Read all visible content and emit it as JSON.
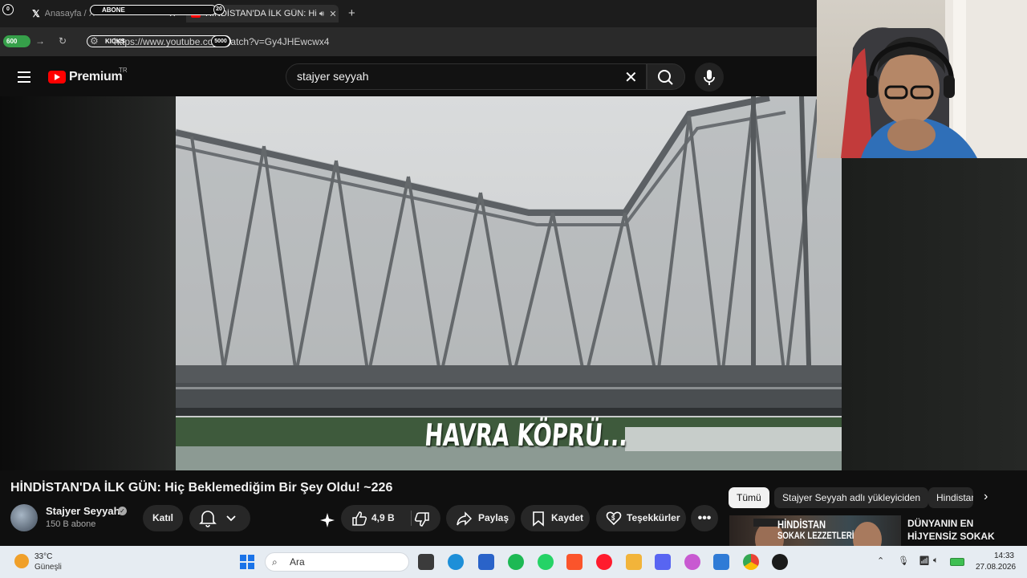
{
  "browser": {
    "tabs": [
      {
        "label": "Anasayfa / X",
        "active": false
      },
      {
        "label": "HİNDİSTAN'DA İLK GÜN: Hiç",
        "active": true
      }
    ],
    "new_tab_label": "+",
    "url": "https://www.youtube.com/watch?v=Gy4JHEwcwx4"
  },
  "stream_overlay": {
    "abone_label": "ABONE",
    "abone_count": "20",
    "left_count": "0",
    "green_count": "600",
    "kicks_label": "KICKS",
    "kicks_goal": "5000"
  },
  "youtube": {
    "logo_text": "Premium",
    "region": "TR",
    "search_query": "stajyer seyyah"
  },
  "video": {
    "caption": "HAVRA KÖPRÜ...",
    "title": "HİNDİSTAN'DA İLK GÜN: Hiç Beklemediğim Bir Şey Oldu! ~226"
  },
  "channel": {
    "name": "Stajyer Seyyah",
    "subscribers": "150 B abone",
    "join_label": "Katıl"
  },
  "actions": {
    "likes": "4,9 B",
    "share": "Paylaş",
    "save": "Kaydet",
    "thanks": "Teşekkürler",
    "more": "•••"
  },
  "chips": [
    "Tümü",
    "Stajyer Seyyah adlı yükleyiciden",
    "Hindistan"
  ],
  "recommended": {
    "thumb_text_1": "HİNDİSTAN",
    "thumb_text_2": "SOKAK LEZZETLERİ",
    "title_1": "DÜNYANIN EN",
    "title_2": "HİJYENSİZ SOKAK"
  },
  "taskbar": {
    "temperature": "33°C",
    "condition": "Güneşli",
    "search_placeholder": "Ara",
    "time": "14:33",
    "date": "27.08.2026"
  },
  "colors": {
    "youtube_red": "#ff0000",
    "background": "#0f0f0f",
    "button_bg": "#272727",
    "taskbar": "#e6ecf2"
  }
}
